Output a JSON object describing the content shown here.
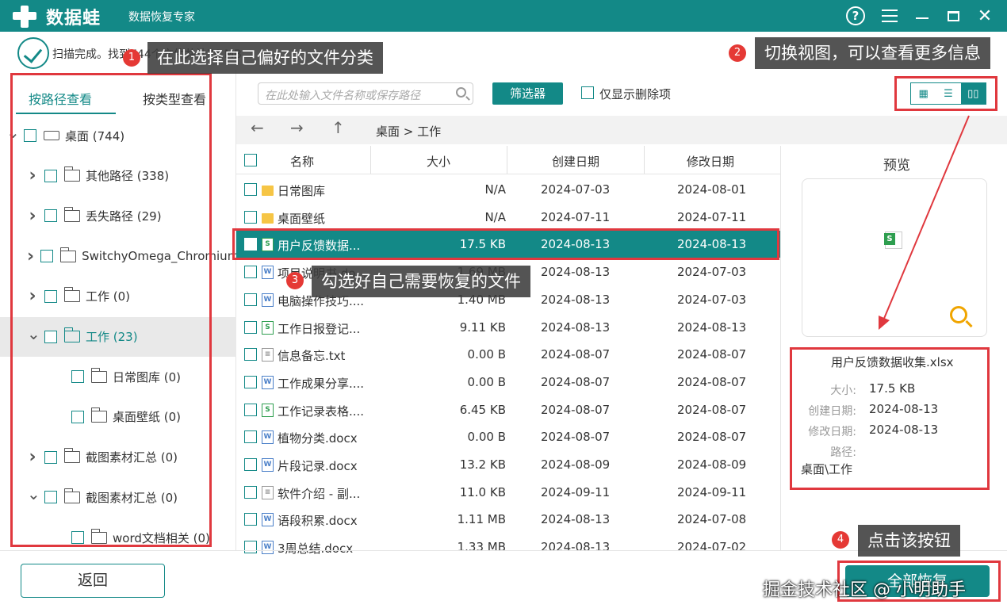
{
  "app": {
    "brand": "数据蛙",
    "subtitle": "数据恢复专家",
    "help_glyph": "?"
  },
  "status": {
    "text": "扫描完成。找到744个文件共计76 MB"
  },
  "annotations": {
    "a1": {
      "num": "1",
      "text": "在此选择自己偏好的文件分类"
    },
    "a2": {
      "num": "2",
      "text": "切换视图，可以查看更多信息"
    },
    "a3": {
      "num": "3",
      "text": "勾选好自己需要恢复的文件"
    },
    "a4": {
      "num": "4",
      "text": "点击该按钮"
    }
  },
  "left_tabs": {
    "by_path": "按路径查看",
    "by_type": "按类型查看"
  },
  "tree": [
    {
      "label": "桌面 (744)",
      "chevron": "down",
      "level": 0,
      "icon": "drive"
    },
    {
      "label": "其他路径 (338)",
      "chevron": "right",
      "level": 1,
      "icon": "folder"
    },
    {
      "label": "丢失路径 (29)",
      "chevron": "right",
      "level": 1,
      "icon": "folder"
    },
    {
      "label": "SwitchyOmega_Chromium",
      "chevron": "right",
      "level": 1,
      "icon": "folder"
    },
    {
      "label": "工作 (0)",
      "chevron": "right",
      "level": 1,
      "icon": "folder"
    },
    {
      "label": "工作 (23)",
      "chevron": "down",
      "level": 1,
      "icon": "folder",
      "selected": true
    },
    {
      "label": "日常图库 (0)",
      "chevron": "",
      "level": 2,
      "icon": "folder"
    },
    {
      "label": "桌面壁纸 (0)",
      "chevron": "",
      "level": 2,
      "icon": "folder"
    },
    {
      "label": "截图素材汇总 (0)",
      "chevron": "right",
      "level": 1,
      "icon": "folder"
    },
    {
      "label": "截图素材汇总 (0)",
      "chevron": "down",
      "level": 1,
      "icon": "folder"
    },
    {
      "label": "word文档相关 (0)",
      "chevron": "",
      "level": 2,
      "icon": "folder"
    }
  ],
  "toolbar": {
    "search_placeholder": "在此处输入文件名称或保存路径",
    "filter_label": "筛选器",
    "deleted_only_label": "仅显示删除项"
  },
  "nav": {
    "back": "←",
    "forward": "→",
    "up": "↑",
    "breadcrumb": "桌面 > 工作"
  },
  "table": {
    "headers": {
      "name": "名称",
      "size": "大小",
      "created": "创建日期",
      "modified": "修改日期"
    },
    "rows": [
      {
        "type": "folder",
        "name": "日常图库",
        "size": "N/A",
        "created": "2024-07-03",
        "modified": "2024-08-01"
      },
      {
        "type": "folder",
        "name": "桌面壁纸",
        "size": "N/A",
        "created": "2024-07-11",
        "modified": "2024-07-11"
      },
      {
        "type": "excel",
        "name": "用户反馈数据...",
        "size": "17.5 KB",
        "created": "2024-08-13",
        "modified": "2024-08-13",
        "selected": true
      },
      {
        "type": "word",
        "name": "项目说明书.do...",
        "size": "1.69 MB",
        "created": "2024-08-13",
        "modified": "2024-07-03"
      },
      {
        "type": "word",
        "name": "电脑操作技巧....",
        "size": "1.40 MB",
        "created": "2024-08-13",
        "modified": "2024-07-03"
      },
      {
        "type": "excel",
        "name": "工作日报登记...",
        "size": "9.11 KB",
        "created": "2024-08-13",
        "modified": "2024-08-13"
      },
      {
        "type": "txt",
        "name": "信息备忘.txt",
        "size": "0.00  B",
        "created": "2024-08-07",
        "modified": "2024-08-07"
      },
      {
        "type": "word",
        "name": "工作成果分享....",
        "size": "0.00  B",
        "created": "2024-08-07",
        "modified": "2024-08-07"
      },
      {
        "type": "excel",
        "name": "工作记录表格....",
        "size": "6.45 KB",
        "created": "2024-08-07",
        "modified": "2024-08-07"
      },
      {
        "type": "word",
        "name": "植物分类.docx",
        "size": "0.00  B",
        "created": "2024-08-07",
        "modified": "2024-08-07"
      },
      {
        "type": "word",
        "name": "片段记录.docx",
        "size": "13.2 KB",
        "created": "2024-08-09",
        "modified": "2024-08-09"
      },
      {
        "type": "txt",
        "name": "软件介绍 - 副...",
        "size": "11.0 KB",
        "created": "2024-09-11",
        "modified": "2024-09-11"
      },
      {
        "type": "word",
        "name": "语段积累.docx",
        "size": "1.11 MB",
        "created": "2024-08-13",
        "modified": "2024-07-08"
      },
      {
        "type": "word",
        "name": "3周总结.docx",
        "size": "1.33 MB",
        "created": "2024-08-13",
        "modified": "2024-07-02"
      }
    ]
  },
  "preview": {
    "title": "预览",
    "file_name": "用户反馈数据收集.xlsx",
    "size_label": "大小:",
    "size": "17.5 KB",
    "created_label": "创建日期:",
    "created": "2024-08-13",
    "modified_label": "修改日期:",
    "modified": "2024-08-13",
    "path_label": "路径:",
    "path": "桌面\\工作"
  },
  "bottom": {
    "back_label": "返回",
    "recover_label": "全部恢复",
    "watermark": "掘金技术社区 @ 小明助手"
  },
  "colors": {
    "accent": "#138987",
    "annotation_red": "#e0383e"
  }
}
